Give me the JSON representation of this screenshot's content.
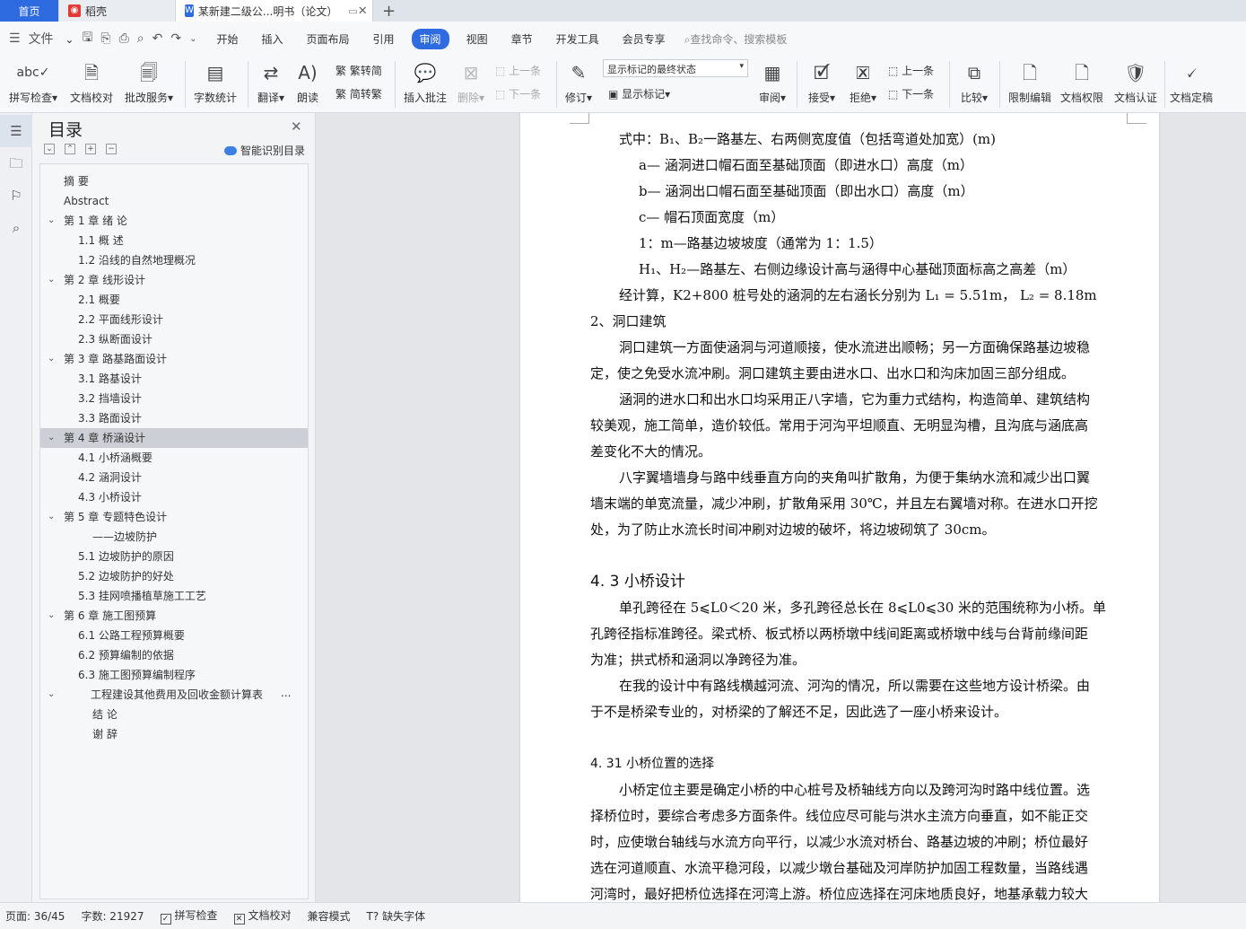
{
  "tabs": {
    "home": "首页",
    "daoke": "稻壳",
    "doc": "某新建二级公...明书（论文）"
  },
  "quick": {
    "file": "文件"
  },
  "menu": [
    "开始",
    "插入",
    "页面布局",
    "引用",
    "审阅",
    "视图",
    "章节",
    "开发工具",
    "会员专享"
  ],
  "search_placeholder": "查找命令、搜索模板",
  "ribbon": {
    "spell": "拼写检查",
    "proof": "文档校对",
    "batch": "批改服务",
    "wordcount": "字数统计",
    "translate": "翻译",
    "read": "朗读",
    "t2s": "繁转简",
    "s2t": "简转繁",
    "comment": "插入批注",
    "delete": "删除",
    "prev": "上一条",
    "next": "下一条",
    "track": "修订",
    "markup_state": "显示标记的最终状态",
    "show_markup": "显示标记",
    "review": "审阅",
    "accept": "接受",
    "reject": "拒绝",
    "prev2": "上一条",
    "next2": "下一条",
    "compare": "比较",
    "restrict": "限制编辑",
    "rights": "文档权限",
    "auth": "文档认证",
    "finalize": "文档定稿"
  },
  "toc": {
    "title": "目录",
    "smart": "智能识别目录",
    "items": [
      {
        "label": "摘  要",
        "level": 1,
        "caret": false
      },
      {
        "label": "Abstract",
        "level": 1,
        "caret": false
      },
      {
        "label": "第 1 章  绪  论",
        "level": 1,
        "caret": true
      },
      {
        "label": "1.1      概      述",
        "level": 2,
        "caret": false
      },
      {
        "label": "1.2      沿线的自然地理概况",
        "level": 2,
        "caret": false
      },
      {
        "label": "第 2 章  线形设计",
        "level": 1,
        "caret": true
      },
      {
        "label": "2.1 概要",
        "level": 2,
        "caret": false
      },
      {
        "label": "2.2 平面线形设计",
        "level": 2,
        "caret": false
      },
      {
        "label": "2.3  纵断面设计",
        "level": 2,
        "caret": false
      },
      {
        "label": "第 3 章  路基路面设计",
        "level": 1,
        "caret": true
      },
      {
        "label": "3.1  路基设计",
        "level": 2,
        "caret": false
      },
      {
        "label": "3.2    挡墙设计",
        "level": 2,
        "caret": false
      },
      {
        "label": "3.3    路面设计",
        "level": 2,
        "caret": false
      },
      {
        "label": "第 4 章  桥涵设计",
        "level": 1,
        "caret": true,
        "selected": true
      },
      {
        "label": "4.1 小桥涵概要",
        "level": 2,
        "caret": false
      },
      {
        "label": "4.2 涵洞设计",
        "level": 2,
        "caret": false
      },
      {
        "label": "4.3 小桥设计",
        "level": 2,
        "caret": false
      },
      {
        "label": "第 5 章    专题特色设计",
        "level": 1,
        "caret": true
      },
      {
        "label": "——边坡防护",
        "level": 3,
        "caret": false
      },
      {
        "label": "5.1 边坡防护的原因",
        "level": 2,
        "caret": false
      },
      {
        "label": "5.2 边坡防护的好处",
        "level": 2,
        "caret": false
      },
      {
        "label": "5.3 挂网喷播植草施工工艺",
        "level": 2,
        "caret": false
      },
      {
        "label": "第 6 章  施工图预算",
        "level": 1,
        "caret": true
      },
      {
        "label": "6.1 公路工程预算概要",
        "level": 2,
        "caret": false
      },
      {
        "label": "6.2 预算编制的依据",
        "level": 2,
        "caret": false
      },
      {
        "label": "6.3 施工图预算编制程序",
        "level": 2,
        "caret": false
      },
      {
        "label": "工程建设其他费用及回收金额计算表",
        "level": 25,
        "caret": true,
        "more": "..."
      },
      {
        "label": "结  论",
        "level": 3,
        "caret": false
      },
      {
        "label": "谢  辞",
        "level": 3,
        "caret": false
      }
    ]
  },
  "doc": {
    "lines": [
      {
        "t": "式中：B₁、B₂一路基左、右两侧宽度值（包括弯道处加宽）(m)",
        "c": "ind"
      },
      {
        "t": "a—    涵洞进口帽石面至基础顶面（即进水口）高度（m）",
        "c": "ind2"
      },
      {
        "t": "b—    涵洞出口帽石面至基础顶面（即出水口）高度（m）",
        "c": "ind2"
      },
      {
        "t": "c—    帽石顶面宽度（m）",
        "c": "ind2"
      },
      {
        "t": "1：m—路基边坡坡度（通常为 1：1.5）",
        "c": "ind2"
      },
      {
        "t": "H₁、H₂—路基左、右侧边缘设计高与涵得中心基础顶面标高之高差（m）",
        "c": "ind2"
      },
      {
        "t": "经计算，K2+800 桩号处的涵洞的左右涵长分别为 L₁ = 5.51m，  L₂ = 8.18m",
        "c": "ind"
      },
      {
        "t": "2、洞口建筑",
        "c": ""
      },
      {
        "t": "洞口建筑一方面使涵洞与河道顺接，使水流进出顺畅；另一方面确保路基边坡稳",
        "c": "ind"
      },
      {
        "t": "定，使之免受水流冲刷。洞口建筑主要由进水口、出水口和沟床加固三部分组成。",
        "c": ""
      },
      {
        "t": "涵洞的进水口和出水口均采用正八字墙，它为重力式结构，构造简单、建筑结构",
        "c": "ind"
      },
      {
        "t": "较美观，施工简单，造价较低。常用于河沟平坦顺直、无明显沟槽，且沟底与涵底高",
        "c": ""
      },
      {
        "t": "差变化不大的情况。",
        "c": ""
      },
      {
        "t": "八字翼墙墙身与路中线垂直方向的夹角叫扩散角，为便于集纳水流和减少出口翼",
        "c": "ind"
      },
      {
        "t": "墙末端的单宽流量，减少冲刷，扩散角采用 30℃，并且左右翼墙对称。在进水口开挖",
        "c": ""
      },
      {
        "t": "处，为了防止水流长时间冲刷对边坡的破坏，将边坡砌筑了 30cm。",
        "c": ""
      },
      {
        "t": "",
        "c": ""
      },
      {
        "t": "4. 3 小桥设计",
        "c": "h2"
      },
      {
        "t": "单孔跨径在 5⩽L0＜20 米，多孔跨径总长在 8⩽L0⩽30 米的范围统称为小桥。单",
        "c": "ind"
      },
      {
        "t": "孔跨径指标准跨径。梁式桥、板式桥以两桥墩中线间距离或桥墩中线与台背前缘间距",
        "c": ""
      },
      {
        "t": "为准；拱式桥和涵洞以净跨径为准。",
        "c": ""
      },
      {
        "t": "在我的设计中有路线横越河流、河沟的情况，所以需要在这些地方设计桥梁。由",
        "c": "ind"
      },
      {
        "t": "于不是桥梁专业的，对桥梁的了解还不足，因此选了一座小桥来设计。",
        "c": ""
      },
      {
        "t": "",
        "c": ""
      },
      {
        "t": "4. 31 小桥位置的选择",
        "c": "h3"
      },
      {
        "t": "小桥定位主要是确定小桥的中心桩号及桥轴线方向以及跨河沟时路中线位置。选",
        "c": "ind"
      },
      {
        "t": "择桥位时，要综合考虑多方面条件。线位应尽可能与洪水主流方向垂直，如不能正交",
        "c": ""
      },
      {
        "t": "时，应使墩台轴线与水流方向平行，以减少水流对桥台、路基边坡的冲刷；桥位最好",
        "c": ""
      },
      {
        "t": "选在河道顺直、水流平稳河段，以减少墩台基础及河岸防护加固工程数量，当路线遇",
        "c": ""
      },
      {
        "t": "河湾时，最好把桥位选择在河湾上游。桥位应选择在河床地质良好，地基承载力较大",
        "c": ""
      }
    ]
  },
  "status": {
    "page": "页面: 36/45",
    "words": "字数: 21927",
    "spell": "拼写检查",
    "proof": "文档校对",
    "compat": "兼容模式",
    "font": "缺失字体"
  }
}
